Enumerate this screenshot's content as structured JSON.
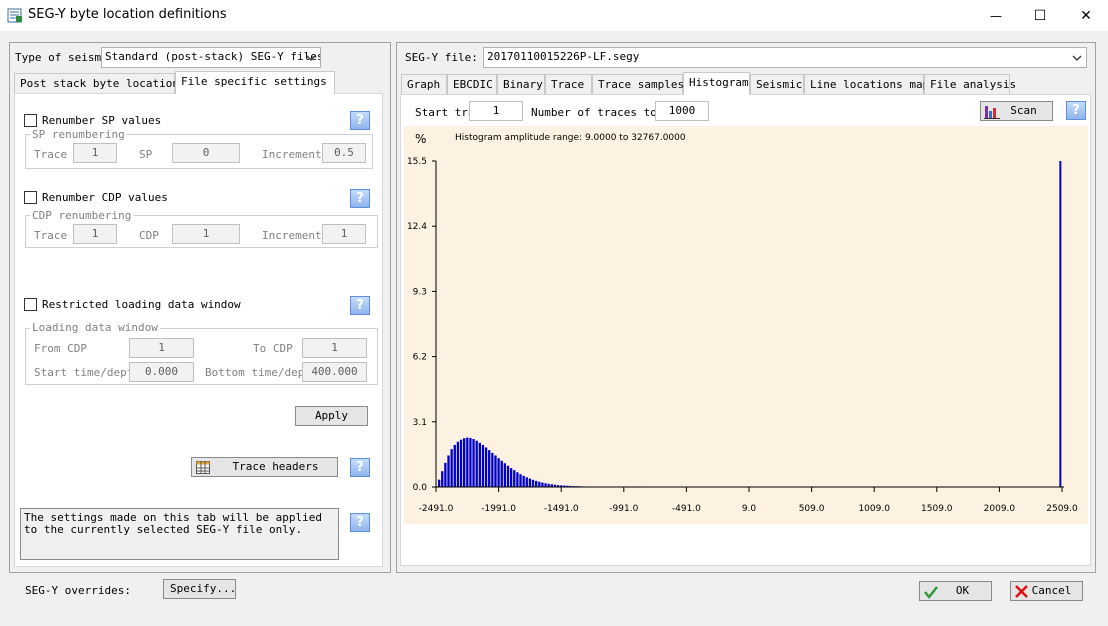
{
  "window": {
    "title": "SEG-Y byte location definitions",
    "minimize": "—",
    "maximize": "☐",
    "close": "✕"
  },
  "left": {
    "seismic_type_label": "Type of seismi",
    "seismic_type_value": "Standard (post-stack) SEG-Y files",
    "tabs": [
      {
        "label": "Post stack byte locations",
        "active": false
      },
      {
        "label": "File specific settings",
        "active": true
      }
    ],
    "sp": {
      "checkbox_label": "Renumber SP values",
      "group": "SP renumbering",
      "trace_label": "Trace",
      "trace_value": "1",
      "sp_label": "SP",
      "sp_value": "0",
      "increment_label": "Increment",
      "increment_value": "0.5"
    },
    "cdp": {
      "checkbox_label": "Renumber CDP values",
      "group": "CDP renumbering",
      "trace_label": "Trace",
      "trace_value": "1",
      "cdp_label": "CDP",
      "cdp_value": "1",
      "increment_label": "Increment",
      "increment_value": "1"
    },
    "window": {
      "checkbox_label": "Restricted loading data window",
      "group": "Loading data window",
      "from_cdp_label": "From CDP",
      "from_cdp_value": "1",
      "to_cdp_label": "To CDP",
      "to_cdp_value": "1",
      "start_label": "Start time/depth",
      "start_value": "0.000",
      "bottom_label": "Bottom time/depth",
      "bottom_value": "400.000"
    },
    "apply_label": "Apply",
    "trace_headers_label": "Trace headers",
    "note": "The settings made on this tab will be applied to the currently selected SEG-Y file only.",
    "help": "?"
  },
  "right": {
    "file_label": "SEG-Y file:",
    "file_value": "20170110015226P-LF.segy",
    "tabs": [
      {
        "label": "Graph",
        "active": false
      },
      {
        "label": "EBCDIC",
        "active": false
      },
      {
        "label": "Binary",
        "active": false
      },
      {
        "label": "Trace",
        "active": false
      },
      {
        "label": "Trace samples",
        "active": false
      },
      {
        "label": "Histogram",
        "active": true
      },
      {
        "label": "Seismic",
        "active": false
      },
      {
        "label": "Line locations map",
        "active": false
      },
      {
        "label": "File analysis",
        "active": false
      }
    ],
    "start_trace_label": "Start tra",
    "start_trace_value": "1",
    "num_traces_label": "Number of traces to s",
    "num_traces_value": "1000",
    "scan_label": "Scan"
  },
  "chart_data": {
    "type": "bar",
    "title": "Histogram amplitude range: 9.0000  to  32767.0000",
    "ylabel": "%",
    "y_ticks": [
      "15.5",
      "12.4",
      "9.3",
      "6.2",
      "3.1",
      "0.0"
    ],
    "x_ticks": [
      "-2491.0",
      "-1991.0",
      "-1491.0",
      "-991.0",
      "-491.0",
      "9.0",
      "509.0",
      "1009.0",
      "1509.0",
      "2009.0",
      "2509.0"
    ],
    "xlim": [
      -2491,
      2509
    ],
    "ylim": [
      0,
      15.5
    ],
    "color": "#0000cc",
    "bin_width": 25,
    "x": [
      -2466,
      -2441,
      -2416,
      -2391,
      -2366,
      -2341,
      -2316,
      -2291,
      -2266,
      -2241,
      -2216,
      -2191,
      -2166,
      -2141,
      -2116,
      -2091,
      -2066,
      -2041,
      -2016,
      -1991,
      -1966,
      -1941,
      -1916,
      -1891,
      -1866,
      -1841,
      -1816,
      -1791,
      -1766,
      -1741,
      -1716,
      -1691,
      -1666,
      -1641,
      -1616,
      -1591,
      -1566,
      -1541,
      -1516,
      -1491,
      -1466,
      -1441,
      -1416,
      -1391,
      -1366,
      -1341,
      -1316,
      -1291,
      -1266,
      -1241,
      -1216,
      -1191,
      -1166,
      -1141,
      -1116,
      -1091,
      -1066,
      -1041,
      -1016,
      -991,
      -966,
      -941,
      -916,
      -891,
      -866,
      -841,
      2496
    ],
    "values": [
      0.35,
      0.75,
      1.15,
      1.5,
      1.8,
      2.0,
      2.15,
      2.25,
      2.32,
      2.35,
      2.33,
      2.28,
      2.2,
      2.1,
      2.0,
      1.88,
      1.75,
      1.62,
      1.5,
      1.37,
      1.25,
      1.13,
      1.01,
      0.9,
      0.8,
      0.7,
      0.61,
      0.53,
      0.46,
      0.4,
      0.34,
      0.29,
      0.25,
      0.21,
      0.18,
      0.15,
      0.13,
      0.11,
      0.09,
      0.08,
      0.07,
      0.06,
      0.05,
      0.045,
      0.04,
      0.035,
      0.03,
      0.025,
      0.02,
      0.02,
      0.015,
      0.015,
      0.012,
      0.01,
      0.01,
      0.008,
      0.008,
      0.006,
      0.006,
      0.005,
      0.005,
      0.004,
      0.004,
      0.003,
      0.003,
      0.003,
      15.5
    ]
  },
  "bottom": {
    "overrides_label": "SEG-Y overrides:",
    "specify_label": "Specify...",
    "ok_label": "OK",
    "cancel_label": "Cancel"
  }
}
